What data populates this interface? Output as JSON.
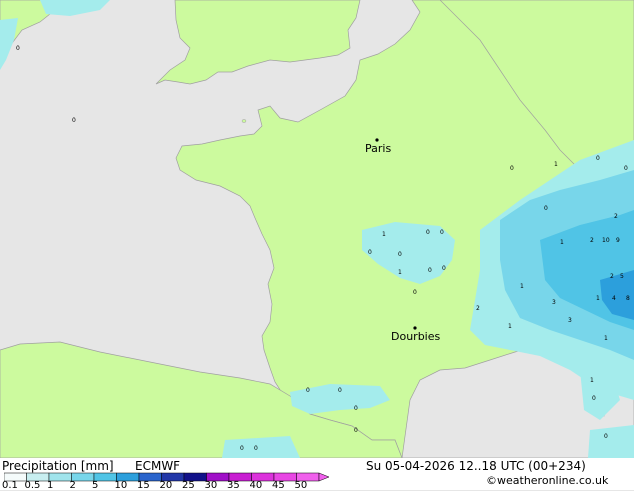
{
  "map": {
    "cities": [
      {
        "name": "Paris"
      },
      {
        "name": "Dourbies"
      }
    ],
    "point_values": [
      "0",
      "0",
      "1",
      "0",
      "0",
      "0",
      "0",
      "1",
      "0",
      "0",
      "0",
      "2",
      "1",
      "2",
      "10",
      "9",
      "1",
      "2",
      "5",
      "3",
      "1",
      "4",
      "8",
      "1",
      "2",
      "3",
      "1",
      "0",
      "1",
      "0",
      "0",
      "0",
      "0",
      "0",
      "0",
      "0",
      "0",
      "0",
      "1",
      "0",
      "0"
    ]
  },
  "footer": {
    "title": "Precipitation [mm]",
    "model": "ECMWF",
    "datetime": "Su 05-04-2026 12..18 UTC (00+234)",
    "credit": "©weatheronline.co.uk",
    "scale": {
      "labels": [
        "0.1",
        "0.5",
        "1",
        "2",
        "5",
        "10",
        "15",
        "20",
        "25",
        "30",
        "35",
        "40",
        "45",
        "50"
      ],
      "colors": [
        "#f5fbfb",
        "#c8eef0",
        "#a0e4ec",
        "#78d6ea",
        "#50c4e6",
        "#2c9fdc",
        "#2a64cc",
        "#2237a8",
        "#12128a",
        "#a010c8",
        "#c81ed2",
        "#dc32dc",
        "#e846e4",
        "#f060ec"
      ]
    },
    "colors": {
      "land": "#ccfa9e",
      "sea": "#e6e6e6",
      "precip_light": "#a4ecec",
      "precip_mid": "#78d6ea",
      "precip_high": "#50c4e6"
    }
  }
}
